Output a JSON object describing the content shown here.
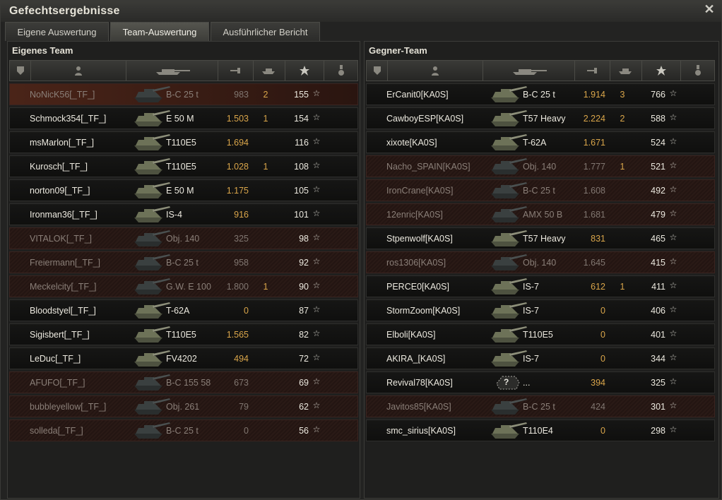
{
  "window": {
    "title": "Gefechtsergebnisse",
    "close_glyph": "✕"
  },
  "tabs": [
    {
      "label": "Eigene Auswertung"
    },
    {
      "label": "Team-Auswertung"
    },
    {
      "label": "Ausführlicher Bericht"
    }
  ],
  "active_tab": "Team-Auswertung",
  "own_team": {
    "title": "Eigenes Team",
    "rows": [
      {
        "player": "NoNicK56[_TF_]",
        "vehicle": "B-C 25 t",
        "damage": "983",
        "kills": "2",
        "xp": "155",
        "dead": true,
        "self": true
      },
      {
        "player": "Schmock354[_TF_]",
        "vehicle": "E 50 M",
        "damage": "1.503",
        "kills": "1",
        "xp": "154",
        "dead": false
      },
      {
        "player": "msMarlon[_TF_]",
        "vehicle": "T110E5",
        "damage": "1.694",
        "kills": "",
        "xp": "116",
        "dead": false
      },
      {
        "player": "Kurosch[_TF_]",
        "vehicle": "T110E5",
        "damage": "1.028",
        "kills": "1",
        "xp": "108",
        "dead": false
      },
      {
        "player": "norton09[_TF_]",
        "vehicle": "E 50 M",
        "damage": "1.175",
        "kills": "",
        "xp": "105",
        "dead": false
      },
      {
        "player": "Ironman36[_TF_]",
        "vehicle": "IS-4",
        "damage": "916",
        "kills": "",
        "xp": "101",
        "dead": false
      },
      {
        "player": "VITALOK[_TF_]",
        "vehicle": "Obj. 140",
        "damage": "325",
        "kills": "",
        "xp": "98",
        "dead": true
      },
      {
        "player": "Freiermann[_TF_]",
        "vehicle": "B-C 25 t",
        "damage": "958",
        "kills": "",
        "xp": "92",
        "dead": true
      },
      {
        "player": "Meckelcity[_TF_]",
        "vehicle": "G.W. E 100",
        "damage": "1.800",
        "kills": "1",
        "xp": "90",
        "dead": true
      },
      {
        "player": "Bloodstyel[_TF_]",
        "vehicle": "T-62A",
        "damage": "0",
        "kills": "",
        "xp": "87",
        "dead": false
      },
      {
        "player": "Sigisbert[_TF_]",
        "vehicle": "T110E5",
        "damage": "1.565",
        "kills": "",
        "xp": "82",
        "dead": false
      },
      {
        "player": "LeDuc[_TF_]",
        "vehicle": "FV4202",
        "damage": "494",
        "kills": "",
        "xp": "72",
        "dead": false
      },
      {
        "player": "AFUFO[_TF_]",
        "vehicle": "B-C 155 58",
        "damage": "673",
        "kills": "",
        "xp": "69",
        "dead": true
      },
      {
        "player": "bubbleyellow[_TF_]",
        "vehicle": "Obj. 261",
        "damage": "79",
        "kills": "",
        "xp": "62",
        "dead": true
      },
      {
        "player": "solleda[_TF_]",
        "vehicle": "B-C 25 t",
        "damage": "0",
        "kills": "",
        "xp": "56",
        "dead": true
      }
    ]
  },
  "enemy_team": {
    "title": "Gegner-Team",
    "rows": [
      {
        "player": "ErCanit0[KA0S]",
        "vehicle": "B-C 25 t",
        "damage": "1.914",
        "kills": "3",
        "xp": "766",
        "dead": false
      },
      {
        "player": "CawboyESP[KA0S]",
        "vehicle": "T57 Heavy",
        "damage": "2.224",
        "kills": "2",
        "xp": "588",
        "dead": false
      },
      {
        "player": "xixote[KA0S]",
        "vehicle": "T-62A",
        "damage": "1.671",
        "kills": "",
        "xp": "524",
        "dead": false
      },
      {
        "player": "Nacho_SPAIN[KA0S]",
        "vehicle": "Obj. 140",
        "damage": "1.777",
        "kills": "1",
        "xp": "521",
        "dead": true
      },
      {
        "player": "IronCrane[KA0S]",
        "vehicle": "B-C 25 t",
        "damage": "1.608",
        "kills": "",
        "xp": "492",
        "dead": true
      },
      {
        "player": "12enric[KA0S]",
        "vehicle": "AMX 50 B",
        "damage": "1.681",
        "kills": "",
        "xp": "479",
        "dead": true
      },
      {
        "player": "Stpenwolf[KA0S]",
        "vehicle": "T57 Heavy",
        "damage": "831",
        "kills": "",
        "xp": "465",
        "dead": false
      },
      {
        "player": "ros1306[KA0S]",
        "vehicle": "Obj. 140",
        "damage": "1.645",
        "kills": "",
        "xp": "415",
        "dead": true
      },
      {
        "player": "PERCE0[KA0S]",
        "vehicle": "IS-7",
        "damage": "612",
        "kills": "1",
        "xp": "411",
        "dead": false
      },
      {
        "player": "StormZoom[KA0S]",
        "vehicle": "IS-7",
        "damage": "0",
        "kills": "",
        "xp": "406",
        "dead": false
      },
      {
        "player": "Elboli[KA0S]",
        "vehicle": "T110E5",
        "damage": "0",
        "kills": "",
        "xp": "401",
        "dead": false
      },
      {
        "player": "AKIRA_[KA0S]",
        "vehicle": "IS-7",
        "damage": "0",
        "kills": "",
        "xp": "344",
        "dead": false
      },
      {
        "player": "Revival78[KA0S]",
        "vehicle": "...",
        "damage": "394",
        "kills": "",
        "xp": "325",
        "dead": false,
        "unknown": true
      },
      {
        "player": "Javitos85[KA0S]",
        "vehicle": "B-C 25 t",
        "damage": "424",
        "kills": "",
        "xp": "301",
        "dead": true
      },
      {
        "player": "smc_sirius[KA0S]",
        "vehicle": "T110E4",
        "damage": "0",
        "kills": "",
        "xp": "298",
        "dead": false
      }
    ]
  },
  "icons": {
    "header": [
      "squad-icon",
      "player-icon",
      "vehicle-icon",
      "damage-icon",
      "kills-icon",
      "xp-star-icon",
      "medal-icon"
    ],
    "star_glyph": "☆",
    "unknown_tank_glyph": "?"
  },
  "colors": {
    "damage": "#d9a54a",
    "dead_row": "#2a1a16"
  }
}
